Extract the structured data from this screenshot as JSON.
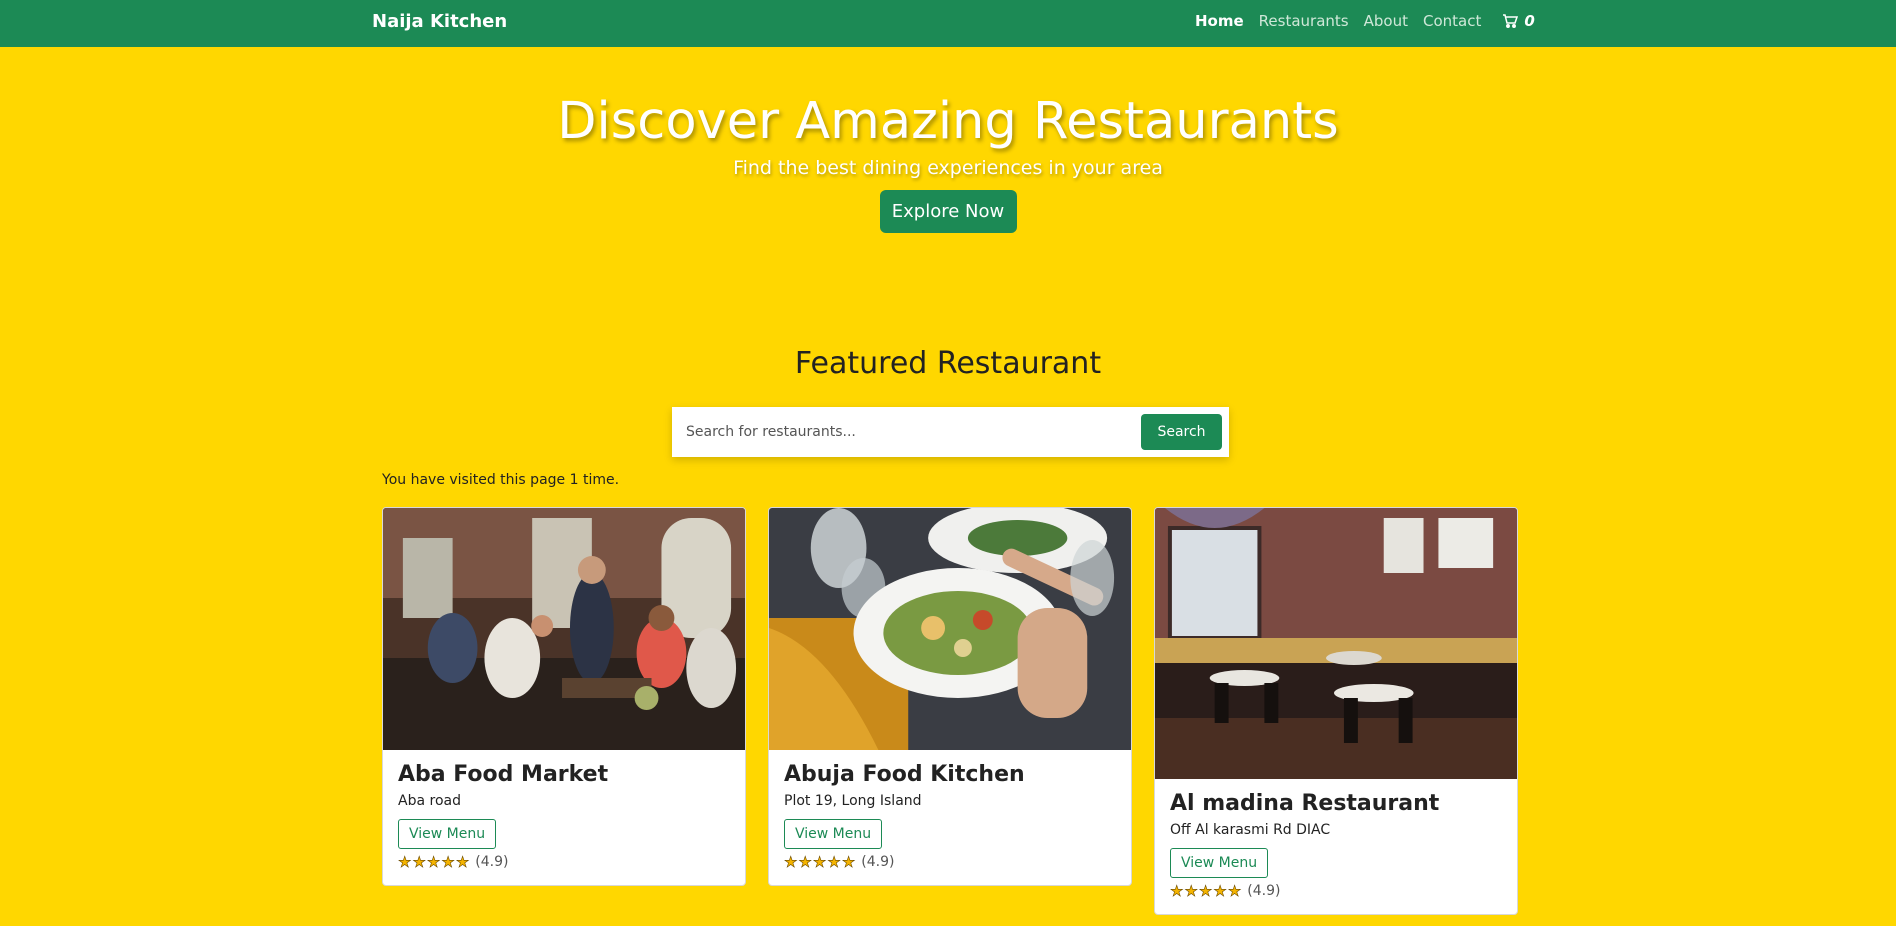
{
  "navbar": {
    "brand": "Naija Kitchen",
    "links": [
      "Home",
      "Restaurants",
      "About",
      "Contact"
    ],
    "active": "Home",
    "cart_icon": "cart-icon",
    "cart_count": "0"
  },
  "hero": {
    "title": "Discover Amazing Restaurants",
    "subtitle": "Find the best dining experiences in your area",
    "button": "Explore Now"
  },
  "featured": {
    "title": "Featured Restaurant",
    "search_placeholder": "Search for restaurants...",
    "search_button": "Search",
    "visits": "You have visited this page 1 time."
  },
  "restaurants": [
    {
      "name": "Aba Food Market",
      "address": "Aba road",
      "button": "View Menu",
      "rating": "(4.9)",
      "stars": 5
    },
    {
      "name": "Abuja Food Kitchen",
      "address": "Plot 19, Long Island",
      "button": "View Menu",
      "rating": "(4.9)",
      "stars": 5
    },
    {
      "name": "Al madina Restaurant",
      "address": "Off Al karasmi Rd DIAC",
      "button": "View Menu",
      "rating": "(4.9)",
      "stars": 5
    }
  ],
  "colors": {
    "primary": "#1C8A55",
    "background": "#FFD700"
  }
}
